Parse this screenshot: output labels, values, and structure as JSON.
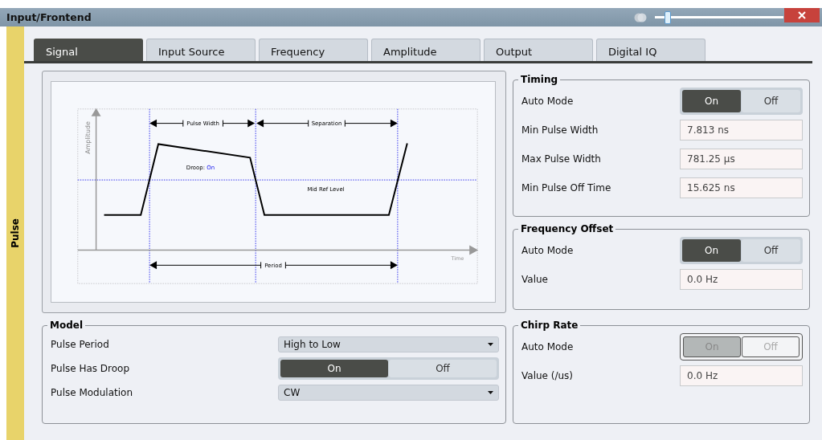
{
  "window": {
    "title": "Input/Frontend",
    "opacity_slider": {
      "level": 0.08
    }
  },
  "side_tab": {
    "label": "Pulse"
  },
  "tabs": [
    {
      "label": "Signal",
      "selected": true
    },
    {
      "label": "Input Source",
      "selected": false
    },
    {
      "label": "Frequency",
      "selected": false
    },
    {
      "label": "Amplitude",
      "selected": false
    },
    {
      "label": "Output",
      "selected": false
    },
    {
      "label": "Digital IQ",
      "selected": false
    }
  ],
  "diagram": {
    "pulse_width": "Pulse Width",
    "separation": "Separation",
    "droop_label": "Droop:",
    "droop_value": "On",
    "mid_ref": "Mid Ref Level",
    "period": "Period",
    "y_axis": "Amplitude",
    "x_axis": "Time"
  },
  "model": {
    "title": "Model",
    "rows": [
      {
        "kind": "dropdown",
        "label": "Pulse Period",
        "value": "High to Low"
      },
      {
        "kind": "toggle",
        "label": "Pulse Has Droop",
        "disabled": false,
        "options": [
          {
            "label": "On",
            "selected": true
          },
          {
            "label": "Off",
            "selected": false
          }
        ]
      },
      {
        "kind": "dropdown",
        "label": "Pulse Modulation",
        "value": "CW"
      }
    ]
  },
  "groups": [
    {
      "title": "Timing",
      "rows": [
        {
          "kind": "toggle",
          "label": "Auto Mode",
          "disabled": false,
          "options": [
            {
              "label": "On",
              "selected": true
            },
            {
              "label": "Off",
              "selected": false
            }
          ]
        },
        {
          "kind": "field",
          "label": "Min Pulse Width",
          "value": "7.813 ns"
        },
        {
          "kind": "field",
          "label": "Max Pulse Width",
          "value": "781.25 µs"
        },
        {
          "kind": "field",
          "label": "Min Pulse Off Time",
          "value": "15.625 ns"
        }
      ]
    },
    {
      "title": "Frequency Offset",
      "rows": [
        {
          "kind": "toggle",
          "label": "Auto Mode",
          "disabled": false,
          "options": [
            {
              "label": "On",
              "selected": true
            },
            {
              "label": "Off",
              "selected": false
            }
          ]
        },
        {
          "kind": "field",
          "label": "Value",
          "value": "0.0 Hz"
        }
      ]
    },
    {
      "title": "Chirp Rate",
      "rows": [
        {
          "kind": "toggle",
          "label": "Auto Mode",
          "disabled": true,
          "options": [
            {
              "label": "On",
              "selected": true
            },
            {
              "label": "Off",
              "selected": false
            }
          ]
        },
        {
          "kind": "field",
          "label": "Value (/us)",
          "value": "0.0 Hz"
        }
      ]
    }
  ]
}
